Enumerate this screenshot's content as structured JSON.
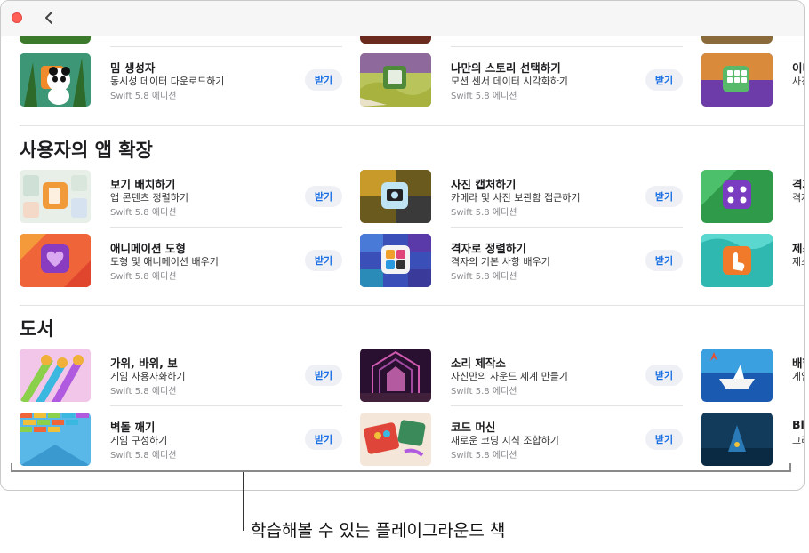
{
  "window": {
    "back_label": "‹"
  },
  "sections": {
    "extend": {
      "title": "사용자의 앱 확장"
    },
    "books": {
      "title": "도서"
    }
  },
  "get_label": "받기",
  "rows": {
    "top": [
      {
        "title": "밈 생성자",
        "subtitle": "동시성 데이터 다운로드하기",
        "edition": "Swift 5.8 에디션"
      },
      {
        "title": "나만의 스토리 선택하기",
        "subtitle": "모션 센서 데이터 시각화하기",
        "edition": "Swift 5.8 에디션"
      },
      {
        "title": "이미",
        "subtitle": "사진"
      }
    ],
    "extend1": [
      {
        "title": "보기 배치하기",
        "subtitle": "앱 콘텐츠 정렬하기",
        "edition": "Swift 5.8 에디션"
      },
      {
        "title": "사진 캡처하기",
        "subtitle": "카메라 및 사진 보관함 접근하기",
        "edition": "Swift 5.8 에디션"
      },
      {
        "title": "격자",
        "subtitle": "격자"
      }
    ],
    "extend2": [
      {
        "title": "애니메이션 도형",
        "subtitle": "도형 및 애니메이션 배우기",
        "edition": "Swift 5.8 에디션"
      },
      {
        "title": "격자로 정렬하기",
        "subtitle": "격자의 기본 사항 배우기",
        "edition": "Swift 5.8 에디션"
      },
      {
        "title": "제스",
        "subtitle": "제스"
      }
    ],
    "books1": [
      {
        "title": "가위, 바위, 보",
        "subtitle": "게임 사용자화하기",
        "edition": "Swift 5.8 에디션"
      },
      {
        "title": "소리 제작소",
        "subtitle": "자신만의 사운드 세계 만들기",
        "edition": "Swift 5.8 에디션"
      },
      {
        "title": "배합",
        "subtitle": "게임"
      }
    ],
    "books2": [
      {
        "title": "벽돌 깨기",
        "subtitle": "게임 구성하기",
        "edition": "Swift 5.8 에디션"
      },
      {
        "title": "코드 머신",
        "subtitle": "새로운 코딩 지식 조합하기",
        "edition": "Swift 5.8 에디션"
      },
      {
        "title": "Bl",
        "subtitle": "그리"
      }
    ]
  },
  "callout": "학습해볼 수 있는 플레이그라운드 책",
  "colors": {
    "accent": "#1a6fe3",
    "close": "#fe5f57",
    "get_bg": "#eef0f5"
  }
}
